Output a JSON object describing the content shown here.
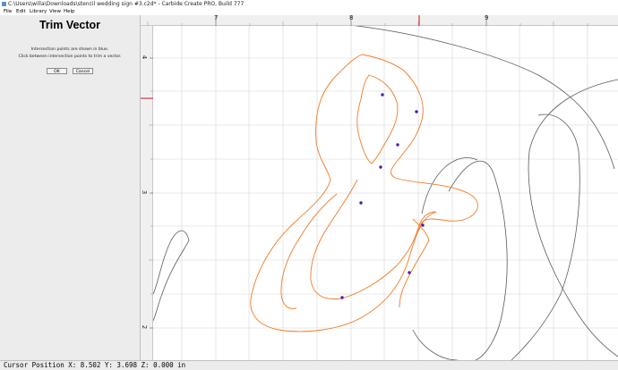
{
  "window": {
    "title": "C:\\Users\\willa\\Downloads\\stencil wedding sign #3.c2d* - Carbide Create PRO, Build 777"
  },
  "menu": {
    "items": [
      "File",
      "Edit",
      "Library",
      "View",
      "Help"
    ]
  },
  "panel": {
    "heading": "Trim Vector",
    "line1": "Intersection points are shown in blue.",
    "line2": "Click between intersection points to trim a vector.",
    "ok_label": "OK",
    "cancel_label": "Cancel"
  },
  "rulers": {
    "top_labels": [
      "7",
      "8",
      "9"
    ],
    "left_labels": [
      "4",
      "3",
      "2"
    ]
  },
  "status": {
    "text": "Cursor Position X: 8.502 Y: 3.698 Z: 0.000 in"
  },
  "colors": {
    "vector_selected": "#f07b25",
    "vector_normal": "#555555",
    "intersection": "#4a1fa8",
    "cursor_marker": "#e0303a",
    "grid": "#d4d4d4"
  }
}
